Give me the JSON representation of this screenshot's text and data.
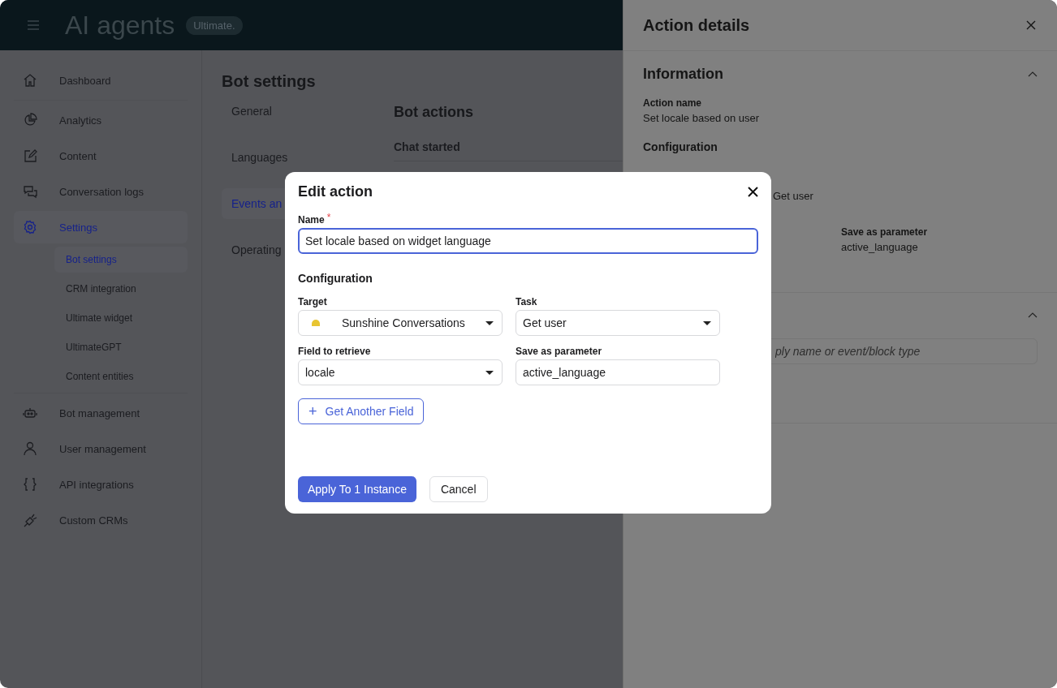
{
  "app_bar": {
    "title": "AI agents",
    "badge": "Ultimate."
  },
  "sidebar": {
    "groups": [
      [
        {
          "label": "Dashboard",
          "selected": false
        }
      ],
      [
        {
          "label": "Analytics",
          "selected": false
        },
        {
          "label": "Content",
          "selected": false
        },
        {
          "label": "Conversation logs",
          "selected": false
        },
        {
          "label": "Settings",
          "selected": true,
          "children": [
            {
              "label": "Bot settings",
              "selected": true
            },
            {
              "label": "CRM integration",
              "selected": false
            },
            {
              "label": "Ultimate widget",
              "selected": false
            },
            {
              "label": "UltimateGPT",
              "selected": false
            },
            {
              "label": "Content entities",
              "selected": false
            }
          ]
        }
      ],
      [
        {
          "label": "Bot management",
          "selected": false
        },
        {
          "label": "User management",
          "selected": false
        },
        {
          "label": "API integrations",
          "selected": false
        },
        {
          "label": "Custom CRMs",
          "selected": false
        }
      ]
    ]
  },
  "main": {
    "title": "Bot settings",
    "nav": [
      {
        "label": "General",
        "selected": false
      },
      {
        "label": "Languages",
        "selected": false
      },
      {
        "label": "Events an",
        "selected": true
      },
      {
        "label": "Operating",
        "selected": false
      }
    ],
    "section_title": "Bot actions",
    "subsection": "Chat started"
  },
  "details_panel": {
    "title": "Action details",
    "information": {
      "heading": "Information",
      "expanded": true,
      "action_name_label": "Action name",
      "action_name": "Set locale based on user",
      "configuration": "Configuration",
      "task_value": "Get user",
      "param_label": "Save as parameter",
      "param_value": "active_language"
    },
    "second_section": {
      "expanded": true,
      "search_placeholder": "ply name or event/block type"
    }
  },
  "modal": {
    "title": "Edit action",
    "name_label": "Name",
    "required_mark": "*",
    "name_value": "Set locale based on widget language",
    "name_focused": true,
    "configuration": "Configuration",
    "fields": [
      {
        "label": "Target",
        "kind": "select",
        "value": "Sunshine Conversations",
        "target_icon": true
      },
      {
        "label": "Task",
        "kind": "select",
        "value": "Get user"
      },
      {
        "label": "Field to retrieve",
        "kind": "select",
        "value": "locale"
      },
      {
        "label": "Save as parameter",
        "kind": "input",
        "value": "active_language"
      }
    ],
    "add_button": {
      "icon": "+",
      "label": "Get Another Field"
    },
    "buttons": [
      {
        "label": "Apply To 1 Instance",
        "kind": "primary"
      },
      {
        "label": "Cancel",
        "kind": "secondary"
      }
    ]
  }
}
